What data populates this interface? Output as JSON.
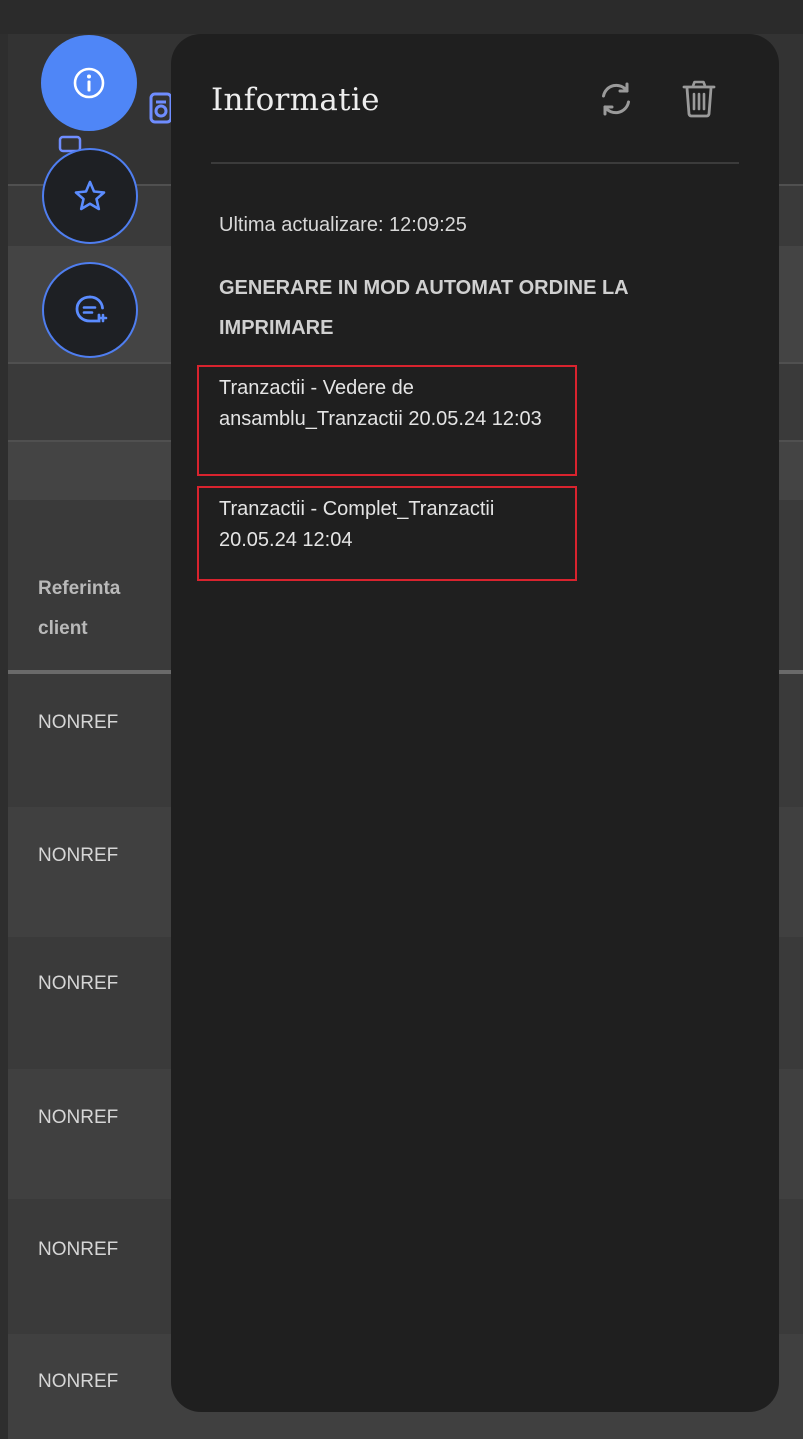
{
  "background_table": {
    "column_header": "Referinta client",
    "rows": [
      "NONREF",
      "NONREF",
      "NONREF",
      "NONREF",
      "NONREF",
      "NONREF"
    ]
  },
  "floating_buttons": [
    {
      "icon": "info-icon",
      "active": true
    },
    {
      "icon": "star-icon",
      "active": false
    },
    {
      "icon": "chat-add-icon",
      "active": false
    }
  ],
  "panel": {
    "title": "Informatie",
    "actions": [
      {
        "icon": "refresh-icon"
      },
      {
        "icon": "trash-icon"
      }
    ],
    "last_update": "Ultima actualizare: 12:09:25",
    "heading": "GENERARE IN MOD AUTOMAT ORDINE LA IMPRIMARE",
    "items": [
      {
        "label": "Tranzactii - Vedere de ansamblu_Tranzactii 20.05.24 12:03"
      },
      {
        "label": "Tranzactii - Complet_Tranzactii 20.05.24 12:04"
      }
    ]
  },
  "colors": {
    "accent": "#4f86f7",
    "panel_bg": "#1f1f1f",
    "page_bg": "#3a3a3a",
    "item_border": "#d9232e"
  }
}
